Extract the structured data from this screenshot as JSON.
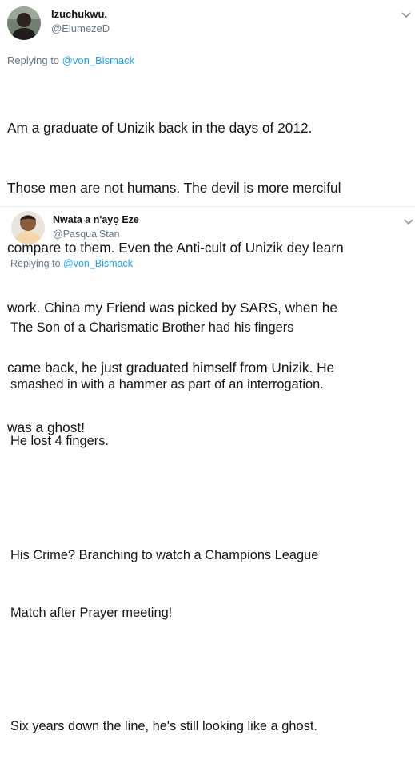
{
  "tweets": [
    {
      "name": "Izuchukwu.",
      "handle": "@ElumezeD",
      "replying_prefix": "Replying to ",
      "replying_to": "@von_Bismack",
      "text_lines": [
        "Am a graduate of Unizik back in the days of 2012.",
        "Those men are not humans. The devil is more merciful",
        "compare to them. Even the Anti-cult of Unizik dey learn",
        "work. China my Friend was picked by SARS, when he",
        "came back, he just graduated himself from Unizik. He",
        "was a ghost!"
      ],
      "menu_icon": "chevron-down-icon"
    },
    {
      "name": "Nwata a n'ayọ Eze",
      "handle": "@PasqualStan",
      "replying_prefix": "Replying to ",
      "replying_to": "@von_Bismack",
      "text_lines": [
        "The Son of a Charismatic Brother had his fingers",
        "smashed in with a hammer as part of an interrogation.",
        "He lost 4 fingers.",
        "",
        "His Crime? Branching to watch a Champions League",
        "Match after Prayer meeting!",
        "",
        "Six years down the line, he's still looking like a ghost."
      ],
      "menu_icon": "chevron-down-icon"
    }
  ],
  "colors": {
    "name": "#14171a",
    "secondary": "#657786",
    "link": "#1da1f2",
    "divider": "#e6ecf0"
  }
}
